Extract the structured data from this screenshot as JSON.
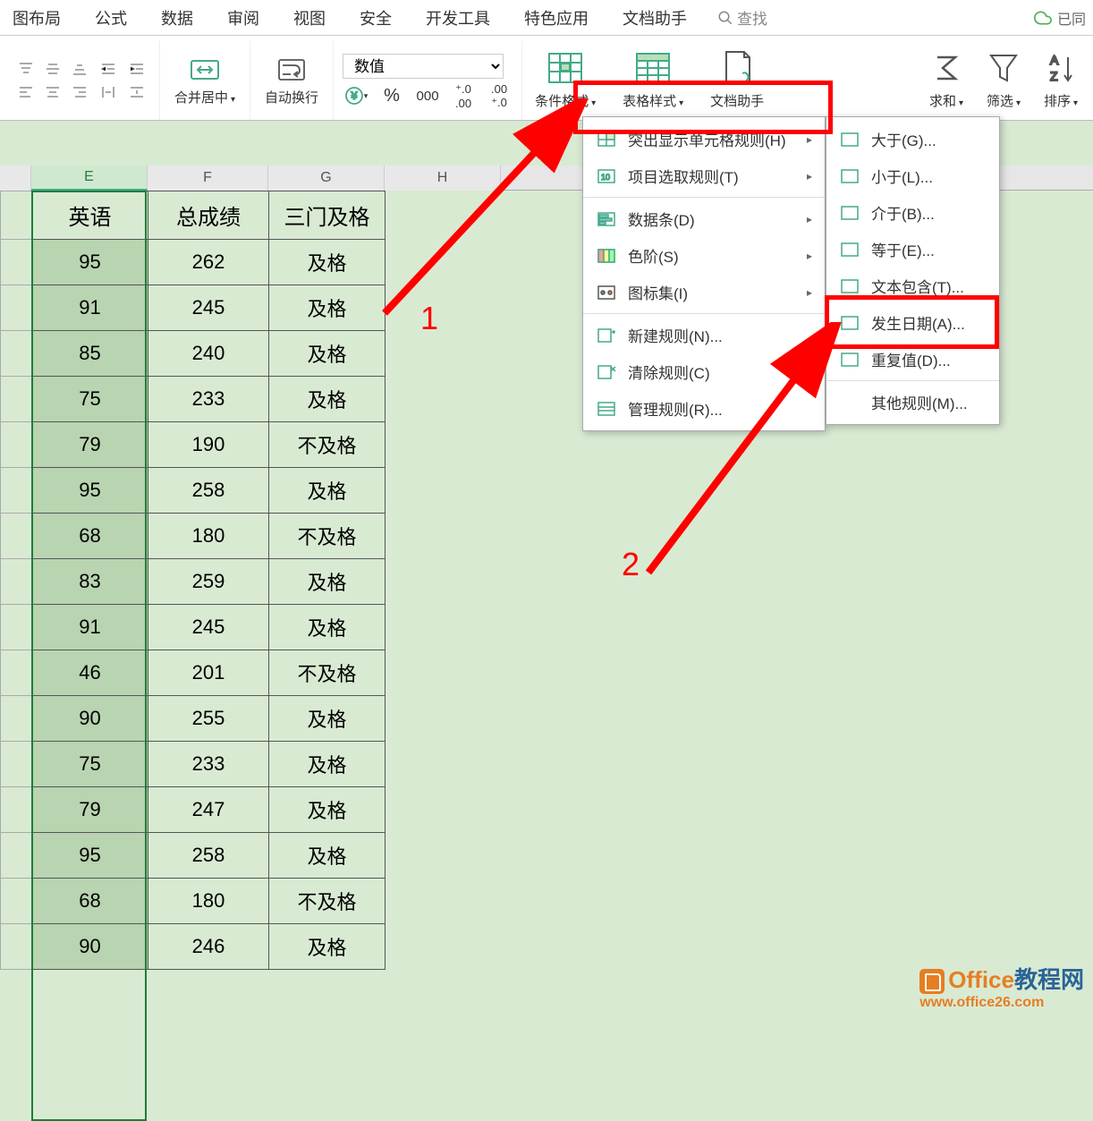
{
  "menu": {
    "tabs": [
      "图布局",
      "公式",
      "数据",
      "审阅",
      "视图",
      "安全",
      "开发工具",
      "特色应用",
      "文档助手"
    ],
    "search_placeholder": "查找",
    "cloud_status": "已同"
  },
  "ribbon": {
    "merge_label": "合并居中",
    "wrap_label": "自动换行",
    "number_format": "数值",
    "conditional_format": "条件格式",
    "table_style": "表格样式",
    "doc_helper": "文档助手",
    "sum_label": "求和",
    "filter_label": "筛选",
    "sort_label": "排序"
  },
  "dropdown1": {
    "items": [
      "突出显示单元格规则(H)",
      "项目选取规则(T)",
      "数据条(D)",
      "色阶(S)",
      "图标集(I)",
      "新建规则(N)...",
      "清除规则(C)",
      "管理规则(R)..."
    ]
  },
  "dropdown2": {
    "items": [
      "大于(G)...",
      "小于(L)...",
      "介于(B)...",
      "等于(E)...",
      "文本包含(T)...",
      "发生日期(A)...",
      "重复值(D)...",
      "其他规则(M)..."
    ]
  },
  "columns": [
    "E",
    "F",
    "G",
    "H"
  ],
  "table": {
    "headers": [
      "英语",
      "总成绩",
      "三门及格"
    ],
    "rows": [
      [
        "95",
        "262",
        "及格"
      ],
      [
        "91",
        "245",
        "及格"
      ],
      [
        "85",
        "240",
        "及格"
      ],
      [
        "75",
        "233",
        "及格"
      ],
      [
        "79",
        "190",
        "不及格"
      ],
      [
        "95",
        "258",
        "及格"
      ],
      [
        "68",
        "180",
        "不及格"
      ],
      [
        "83",
        "259",
        "及格"
      ],
      [
        "91",
        "245",
        "及格"
      ],
      [
        "46",
        "201",
        "不及格"
      ],
      [
        "90",
        "255",
        "及格"
      ],
      [
        "75",
        "233",
        "及格"
      ],
      [
        "79",
        "247",
        "及格"
      ],
      [
        "95",
        "258",
        "及格"
      ],
      [
        "68",
        "180",
        "不及格"
      ],
      [
        "90",
        "246",
        "及格"
      ]
    ]
  },
  "annotations": {
    "num1": "1",
    "num2": "2"
  },
  "watermark": {
    "brand1": "Office",
    "brand2": "教程网",
    "url": "www.office26.com"
  }
}
